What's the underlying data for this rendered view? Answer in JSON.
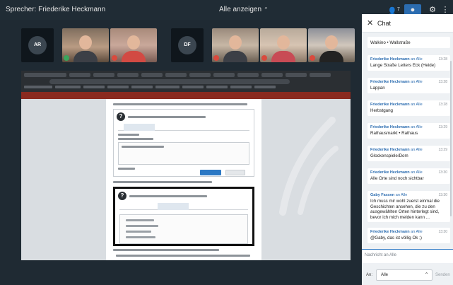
{
  "topbar": {
    "speaker": "Sprecher: Friederike Heckmann",
    "view_mode": "Alle anzeigen",
    "participants_count": "7"
  },
  "video_strip": {
    "avatars": [
      "AR",
      "DF"
    ]
  },
  "chat": {
    "title": "Chat",
    "input_placeholder": "Nachricht an Alle",
    "to_label": "An:",
    "to_value": "Alle",
    "send_label": "Senden",
    "messages": [
      {
        "sender": "",
        "to": "",
        "time": "",
        "text": "Walkino • Wallstraße"
      },
      {
        "sender": "Friederike Heckmann",
        "to": "an Alle",
        "time": "13:28",
        "text": "Lange Straße Letters Eck (Heide)"
      },
      {
        "sender": "Friederike Heckmann",
        "to": "an Alle",
        "time": "13:28",
        "text": "Lappan"
      },
      {
        "sender": "Friederike Heckmann",
        "to": "an Alle",
        "time": "13:28",
        "text": "Herbstgang"
      },
      {
        "sender": "Friederike Heckmann",
        "to": "an Alle",
        "time": "13:29",
        "text": "Rathausmarkt • Rathaus"
      },
      {
        "sender": "Friederike Heckmann",
        "to": "an Alle",
        "time": "13:29",
        "text": "Glockenspiele/Dom"
      },
      {
        "sender": "Friederike Heckmann",
        "to": "an Alle",
        "time": "13:30",
        "text": "Alle Orte sind noch sichtbar"
      },
      {
        "sender": "Gaby Fassen",
        "to": "an Alle",
        "time": "13:30",
        "text": "Ich muss mir wohl zuerst einmal die Geschichten ansehen, die zu den ausgewählten Orten hinterlegt sind, bevor ich mich melden kann ..."
      },
      {
        "sender": "Friederike Heckmann",
        "to": "an Alle",
        "time": "13:30",
        "text": "@Gaby, das ist völlig Ok ;)"
      }
    ]
  },
  "colors": {
    "background": "#1f2a33",
    "chat_bg": "#eef1f4",
    "accent": "#2b6cb0",
    "mic_muted": "#d94a3d"
  },
  "icons": [
    "participants-icon",
    "chat-icon",
    "settings-icon",
    "more-icon",
    "close-icon",
    "question-icon",
    "chevron-down-icon",
    "microphone-icon"
  ]
}
